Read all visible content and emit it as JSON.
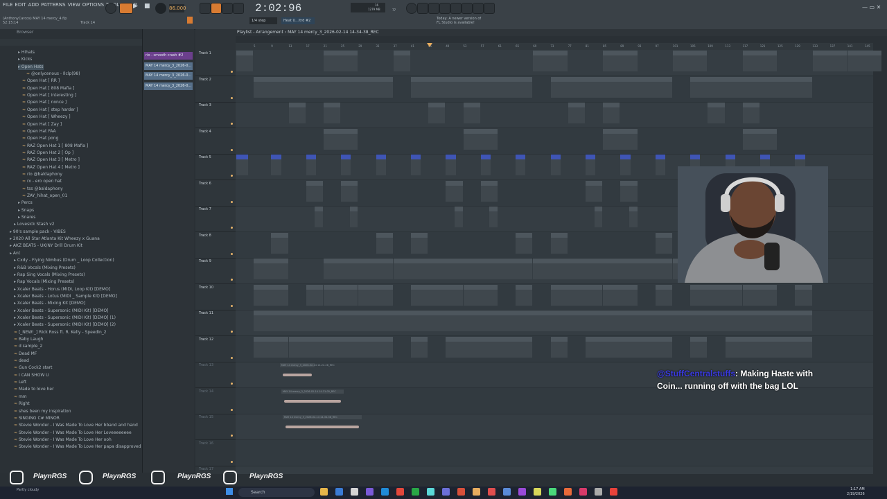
{
  "menubar": {
    "menus": [
      "FILE",
      "EDIT",
      "ADD",
      "PATTERNS",
      "VIEW",
      "OPTIONS",
      "TOOLS",
      "HELP"
    ],
    "tempo": "86.000",
    "time": "2:02:96",
    "snap": "1/4 step",
    "hint_field": "Heat U...ltrd #2",
    "news_line1": "Today: A newer version of",
    "news_line2": "FL Studio is available!",
    "project_line1": "(AnthonyCarcos) MAY 14 mercy_4.flp",
    "project_line2": "52:15:14",
    "project_line3": "Track 14",
    "cpu": "16",
    "ram": "1279 MB",
    "voices": "77"
  },
  "browser": {
    "title": "Browser",
    "items": [
      {
        "label": "Hihats",
        "indent": 2,
        "folder": true
      },
      {
        "label": "Kicks",
        "indent": 2,
        "folder": true
      },
      {
        "label": "Open Hats",
        "indent": 2,
        "folder": true
      },
      {
        "label": "@onlycenous - Ilclp(98)",
        "indent": 4,
        "folder": false
      },
      {
        "label": "Open Hat [ RR ]",
        "indent": 3,
        "folder": false
      },
      {
        "label": "Open Hat [ 808 Mafia ]",
        "indent": 3,
        "folder": false
      },
      {
        "label": "Open Hat [ interesting ]",
        "indent": 3,
        "folder": false
      },
      {
        "label": "Open Hat [ nonce ]",
        "indent": 3,
        "folder": false
      },
      {
        "label": "Open Hat [ step harder ]",
        "indent": 3,
        "folder": false
      },
      {
        "label": "Open Hat [ Wheezy ]",
        "indent": 3,
        "folder": false
      },
      {
        "label": "Open Hat [ Zay ]",
        "indent": 3,
        "folder": false
      },
      {
        "label": "Open Hat FAA",
        "indent": 3,
        "folder": false
      },
      {
        "label": "Open Hat pong",
        "indent": 3,
        "folder": false
      },
      {
        "label": "RAZ Open Hat 1 [ 808 Mafia ]",
        "indent": 3,
        "folder": false
      },
      {
        "label": "RAZ Open Hat 2 [ Op ]",
        "indent": 3,
        "folder": false
      },
      {
        "label": "RAZ Open Hat 3 [ Metro ]",
        "indent": 3,
        "folder": false
      },
      {
        "label": "RAZ Open Hat 4 [ Metro ]",
        "indent": 3,
        "folder": false
      },
      {
        "label": "rio @baldaphony",
        "indent": 3,
        "folder": false
      },
      {
        "label": "rx - ero open hat",
        "indent": 3,
        "folder": false
      },
      {
        "label": "tss @baldaphony",
        "indent": 3,
        "folder": false
      },
      {
        "label": "ZAY_hihat_open_01",
        "indent": 3,
        "folder": false
      },
      {
        "label": "Percs",
        "indent": 2,
        "folder": true
      },
      {
        "label": "Snaps",
        "indent": 2,
        "folder": true
      },
      {
        "label": "Snares",
        "indent": 2,
        "folder": true
      },
      {
        "label": "Lovesick Stash v2",
        "indent": 1,
        "folder": true
      },
      {
        "label": "90's sample pack - VIBES",
        "indent": 0,
        "folder": true
      },
      {
        "label": "2020 All Star Atlanta Kit Wheezy x Guana",
        "indent": 0,
        "folder": true
      },
      {
        "label": "AKZ BEATS - UK/NY Drill Drum Kit",
        "indent": 0,
        "folder": true
      },
      {
        "label": "Ant",
        "indent": 0,
        "folder": true
      },
      {
        "label": "Cxdy - Flying Nimbus (Drum _ Loop Collection)",
        "indent": 1,
        "folder": true
      },
      {
        "label": "R&B Vocals (Mixing Presets)",
        "indent": 1,
        "folder": true
      },
      {
        "label": "Rap Sing Vocals (Mixing Presets)",
        "indent": 1,
        "folder": true
      },
      {
        "label": "Rap Vocals (Mixing Presets)",
        "indent": 1,
        "folder": true
      },
      {
        "label": "Xcaler Beats - Horus (MIDI, Loop Kit) [DEMO]",
        "indent": 1,
        "folder": true
      },
      {
        "label": "Xcaler Beats - Lotus (MIDI _ Sample Kit) [DEMO]",
        "indent": 1,
        "folder": true
      },
      {
        "label": "Xcaler Beats - Mixing Kit [DEMO]",
        "indent": 1,
        "folder": true
      },
      {
        "label": "Xcaler Beats - Supersonic (MIDI Kit) [DEMO]",
        "indent": 1,
        "folder": true
      },
      {
        "label": "Xcaler Beats - Supersonic (MIDI Kit) [DEMO] (1)",
        "indent": 1,
        "folder": true
      },
      {
        "label": "Xcaler Beats - Supersonic (MIDI Kit) [DEMO] (2)",
        "indent": 1,
        "folder": true
      },
      {
        "label": "[_NEW!_] Rick Ross ft. R. Kelly - Speedin_2",
        "indent": 1,
        "folder": false
      },
      {
        "label": "Baby Laugh",
        "indent": 1,
        "folder": false
      },
      {
        "label": "d sample_2",
        "indent": 1,
        "folder": false
      },
      {
        "label": "Dead MF",
        "indent": 1,
        "folder": false
      },
      {
        "label": "dead",
        "indent": 1,
        "folder": false
      },
      {
        "label": "Gun Cock2 start",
        "indent": 1,
        "folder": false
      },
      {
        "label": "I CAN SHOW U",
        "indent": 1,
        "folder": false
      },
      {
        "label": "Left",
        "indent": 1,
        "folder": false
      },
      {
        "label": "Made to love her",
        "indent": 1,
        "folder": false
      },
      {
        "label": "mm",
        "indent": 1,
        "folder": false
      },
      {
        "label": "Right",
        "indent": 1,
        "folder": false
      },
      {
        "label": "shes been my inspiration",
        "indent": 1,
        "folder": false
      },
      {
        "label": "SINGING C# MINOR",
        "indent": 1,
        "folder": false
      },
      {
        "label": "Stevie Wonder - I Was Made To Love Her bband and hand",
        "indent": 1,
        "folder": false
      },
      {
        "label": "Stevie Wonder - I Was Made To Love Her Loveeeeeeee",
        "indent": 1,
        "folder": false
      },
      {
        "label": "Stevie Wonder - I Was Made To Love Her ooh",
        "indent": 1,
        "folder": false
      },
      {
        "label": "Stevie Wonder - I Was Made To Love Her papa disapproved it",
        "indent": 1,
        "folder": false
      }
    ]
  },
  "patterns": [
    {
      "label": "rio - smooth crash #2",
      "color": "#6b3f8c"
    },
    {
      "label": "MAY 14 mercy_3_2026-0...",
      "color": "#566f89"
    },
    {
      "label": "MAY 14 mercy_3_2026-0...",
      "color": "#566f89"
    },
    {
      "label": "MAY 14 mercy_3_2026-0...",
      "color": "#566f89"
    }
  ],
  "playlist": {
    "title": "Playlist - Arrangement › MAY 14 mercy_3_2026-02-14 14-34-38_REC",
    "ruler": [
      "5",
      "9",
      "13",
      "17",
      "21",
      "25",
      "29",
      "33",
      "37",
      "41",
      "45",
      "49",
      "53",
      "57",
      "61",
      "65",
      "69",
      "73",
      "77",
      "81",
      "85",
      "89",
      "93",
      "97",
      "101",
      "105",
      "109",
      "113",
      "117",
      "121",
      "125",
      "129",
      "133",
      "137",
      "141",
      "145"
    ],
    "tracks": [
      "Track 1",
      "Track 2",
      "Track 3",
      "Track 4",
      "Track 5",
      "Track 6",
      "Track 7",
      "Track 8",
      "Track 9",
      "Track 10",
      "Track 11",
      "Track 12",
      "Track 13",
      "Track 14",
      "Track 15",
      "Track 16",
      "Track 17"
    ],
    "audio_clips": [
      "MAY 14 mercy_3_2026-02-14 14-22-28_REC",
      "MAY 14 mercy_3_2026-02-14 14-31-05_REC",
      "MAY 14 mercy_3_2026-02-14 14-34-38_REC"
    ]
  },
  "chat": {
    "user": "@StuffCentralstuffs",
    "message": ": Making Haste with Coin... running off with the bag LOL"
  },
  "overlay": {
    "handles": [
      "PlaynRGS",
      "PlaynRGS",
      "PlaynRGS",
      "PlaynRGS"
    ],
    "icons": [
      "kick-icon",
      "instagram-icon",
      "twitch-icon",
      "youtube-icon"
    ]
  },
  "taskbar": {
    "search": "Search",
    "weather": "Partly cloudy",
    "time": "1:17 AM",
    "date": "2/19/2026"
  }
}
